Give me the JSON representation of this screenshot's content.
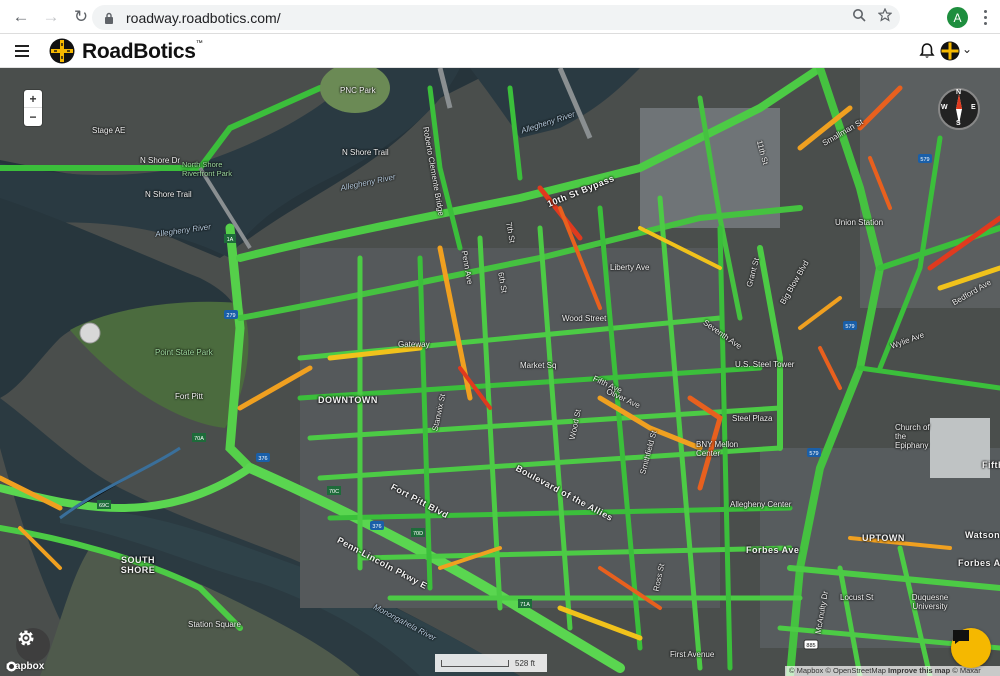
{
  "browser": {
    "url": "roadway.roadbotics.com/",
    "profile_initial": "A"
  },
  "app": {
    "brand": "RoadBotics",
    "trademark": "™"
  },
  "map": {
    "zoom_in": "+",
    "zoom_out": "−",
    "compass": {
      "n": "N",
      "s": "S",
      "e": "E",
      "w": "W"
    },
    "scale_label": "528 ft",
    "mapbox_label": "mapbox",
    "attribution": {
      "mapbox": "© Mapbox",
      "osm": "© OpenStreetMap",
      "improve": "Improve this map",
      "maxar": "© Maxar"
    },
    "labels": {
      "pnc_park": "PNC Park",
      "stage_ae": "Stage AE",
      "north_shore_dr": "N Shore Dr",
      "north_shore_trail_1": "N Shore Trail",
      "north_shore_trail_2": "N Shore Trail",
      "north_shore_park": "North Shore Riverfront Park",
      "allegheny_river_1": "Allegheny River",
      "allegheny_river_2": "Allegheny River",
      "allegheny_river_3": "Allegheny River",
      "clemente_bridge": "Roberto Clemente Bridge",
      "tenth_st_bypass": "10th St Bypass",
      "eleventh_st": "11th St",
      "seventh_st": "7th St",
      "sixth_st": "6th St",
      "grant_st": "Grant St",
      "seventh_ave": "Seventh Ave",
      "big_blow_blvd": "Big Blow Blvd",
      "union_station": "Union Station",
      "smallman_st": "Smallman St",
      "bedford_ave": "Bedford Ave",
      "point_state_park": "Point State Park",
      "fort_pitt": "Fort Pitt",
      "downtown": "DOWNTOWN",
      "gateway": "Gateway",
      "wood_street": "Wood Street",
      "steel_plaza": "Steel Plaza",
      "fifth_ave": "Fifth Ave",
      "oliver_ave": "Oliver Ave",
      "smithfield_st": "Smithfield St",
      "bny_mellon": "BNY Mellon Center",
      "us_steel": "U.S. Steel Tower",
      "fort_pitt_blvd": "Fort Pitt Blvd",
      "blvd_allies": "Boulevard of the Allies",
      "penn_lincoln": "Penn-Lincoln Pkwy E",
      "monongahela": "Monongahela River",
      "south_shore": "SOUTH SHORE",
      "station_square": "Station Square",
      "uptown": "UPTOWN",
      "forbes_ave_1": "Forbes Ave",
      "forbes_ave_2": "Forbes Ave",
      "duquesne": "Duquesne University",
      "locust_st": "Locust St",
      "first_avenue": "First Avenue",
      "watson": "Watson",
      "fifth_e": "Fifth",
      "wylie_ave": "Wylie Ave",
      "market_sq": "Market Sq",
      "liberty_ave": "Liberty Ave",
      "penn_ave": "Penn Ave",
      "stanwix_st": "Stanwix St",
      "wood_st": "Wood St",
      "ross_st": "Ross St",
      "mcanulty": "McAnulty Dr",
      "allegheny_center": "Allegheny Center",
      "church_epiphany": "Church of the Epiphany"
    },
    "highway_shields": [
      "279",
      "1A",
      "70A",
      "376",
      "70C",
      "376",
      "70D",
      "69C",
      "579",
      "579",
      "579",
      "885",
      "71A"
    ]
  }
}
